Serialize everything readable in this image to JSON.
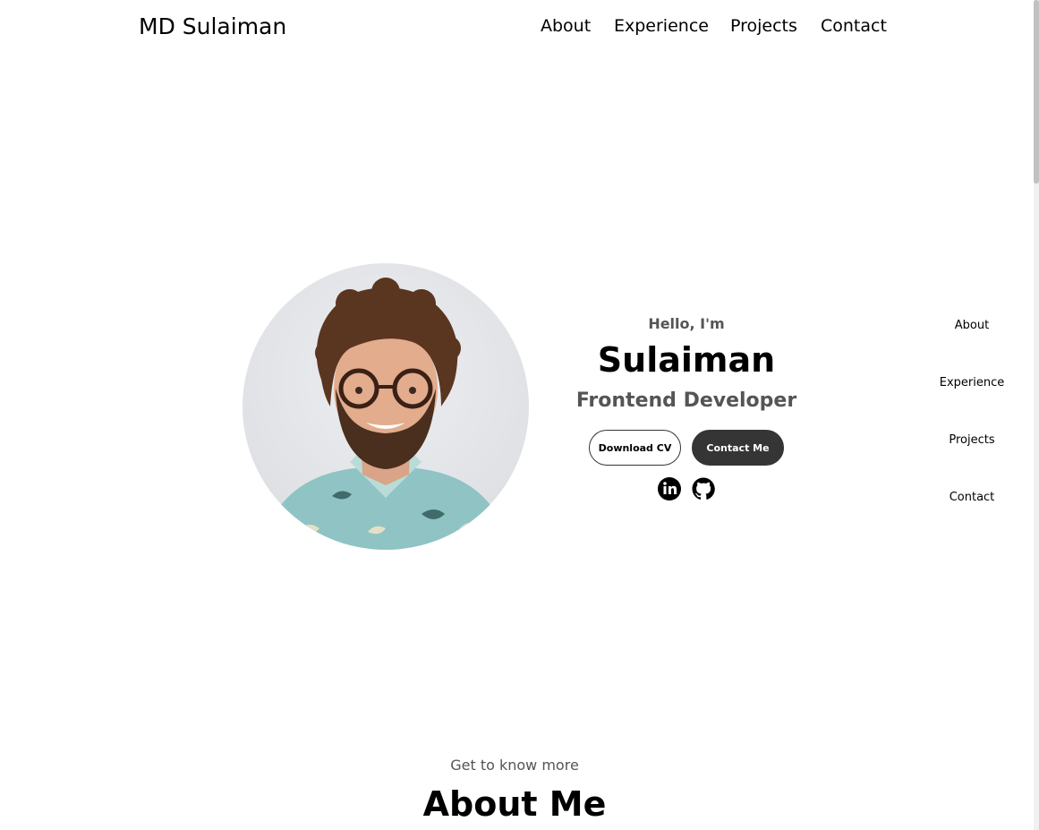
{
  "header": {
    "logo": "MD Sulaiman",
    "nav": [
      "About",
      "Experience",
      "Projects",
      "Contact"
    ]
  },
  "hero": {
    "greeting": "Hello, I'm",
    "name": "Sulaiman",
    "role": "Frontend Developer",
    "buttons": {
      "download_cv": "Download CV",
      "contact_me": "Contact Me"
    },
    "socials": [
      "linkedin-icon",
      "github-icon"
    ]
  },
  "side_nav": [
    "About",
    "Experience",
    "Projects",
    "Contact"
  ],
  "about": {
    "subtitle": "Get to know more",
    "title": "About Me"
  },
  "colors": {
    "primary_text": "#000000",
    "secondary_text": "#555555",
    "button_dark": "#353535",
    "background": "#ffffff"
  }
}
